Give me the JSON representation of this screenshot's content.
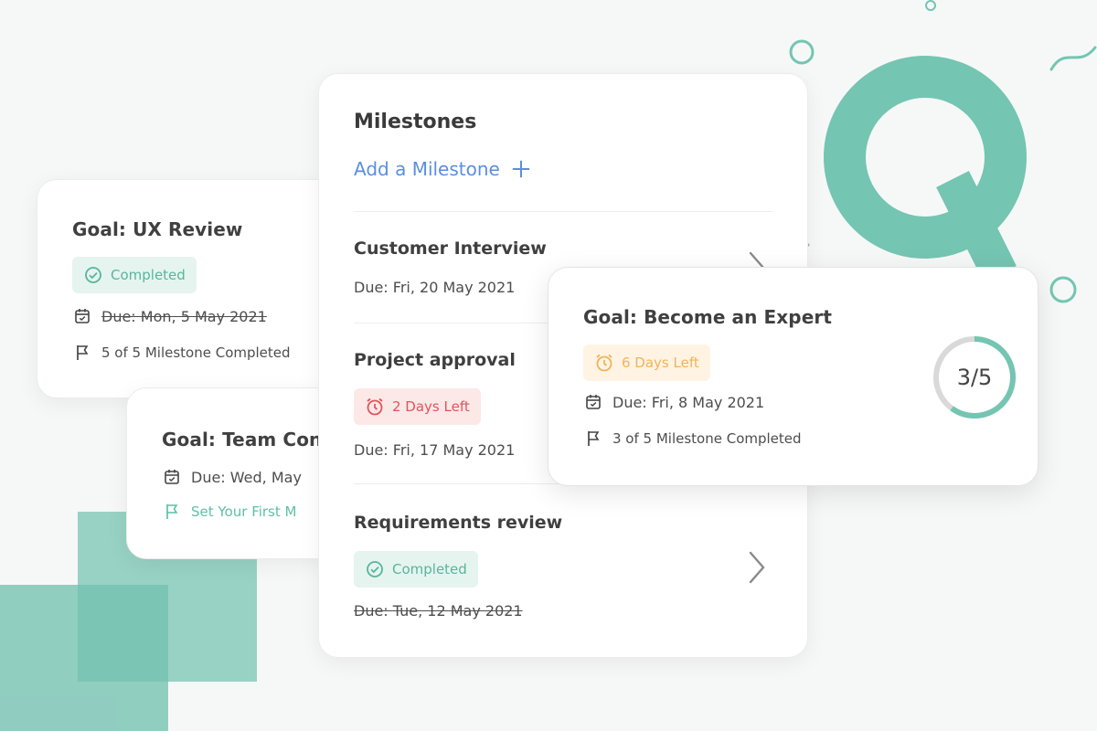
{
  "colors": {
    "accent": "#74c5b2",
    "completed": "#56b69b",
    "overdue": "#e0555a",
    "warning": "#f0b35a",
    "link": "#5a8fe0"
  },
  "goal_ux_review": {
    "title": "Goal: UX Review",
    "status_badge": "Completed",
    "due": "Due: Mon, 5 May 2021",
    "milestones": "5 of 5 Milestone Completed",
    "icons": {
      "status": "check-circle-icon",
      "due": "calendar-icon",
      "milestones": "flag-icon"
    }
  },
  "goal_team": {
    "title": "Goal: Team Con",
    "due": "Due: Wed, May",
    "first_milestone_link": "Set Your First M",
    "icons": {
      "due": "calendar-icon",
      "link": "flag-icon"
    }
  },
  "milestones_panel": {
    "heading": "Milestones",
    "add_label": "Add a Milestone",
    "items": [
      {
        "title": "Customer Interview",
        "due": "Due: Fri, 20 May 2021"
      },
      {
        "title": "Project approval",
        "status_badge": "2 Days Left",
        "due": "Due: Fri, 17 May 2021"
      },
      {
        "title": "Requirements review",
        "status_badge": "Completed",
        "due": "Due: Tue, 12 May 2021"
      }
    ],
    "icons": {
      "add": "plus-icon",
      "open": "chevron-right-icon",
      "overdue": "alarm-clock-icon",
      "done": "check-circle-icon"
    }
  },
  "goal_expert": {
    "title": "Goal: Become an Expert",
    "status_badge": "6 Days Left",
    "due": "Due: Fri, 8 May 2021",
    "milestones": "3 of 5 Milestone Completed",
    "progress_label": "3/5",
    "progress": {
      "completed": 3,
      "total": 5
    },
    "icons": {
      "status": "alarm-clock-icon",
      "due": "calendar-icon",
      "milestones": "flag-icon"
    }
  }
}
